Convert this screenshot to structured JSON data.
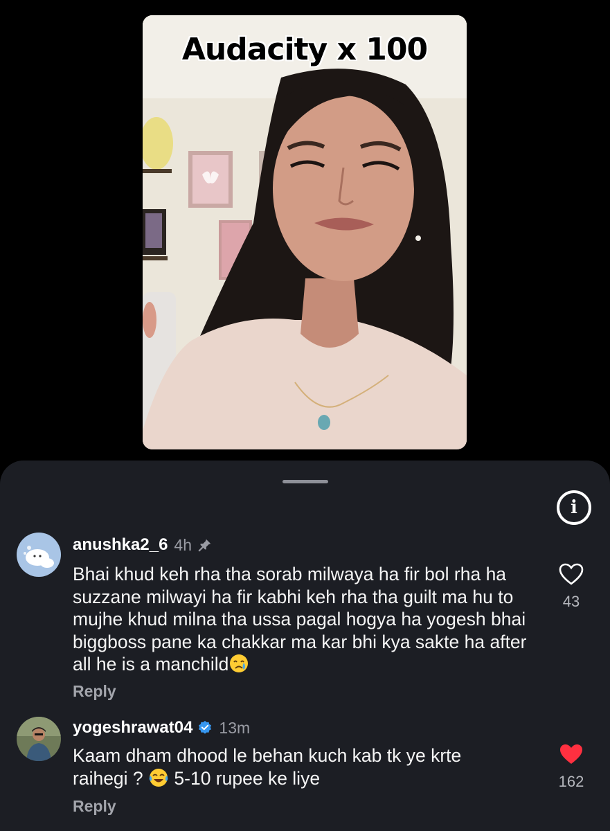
{
  "video": {
    "title": "Audacity x 100"
  },
  "sheet": {
    "info_label": "i"
  },
  "comments": [
    {
      "username": "anushka2_6",
      "time": "4h",
      "pinned": true,
      "text": "Bhai khud keh rha tha sorab milwaya ha fir bol rha ha suzzane milwayi ha  fir kabhi keh rha tha guilt ma hu to mujhe khud milna tha ussa pagal hogya ha yogesh bhai biggboss pane ka chakkar ma kar bhi kya sakte ha after all he is a manchild",
      "emoji": "crying-face",
      "reply": "Reply",
      "likes": "43",
      "liked": false
    },
    {
      "username": "yogeshrawat04",
      "verified": true,
      "time": "13m",
      "text_part1": "Kaam dham dhood le behan kuch kab tk ye krte raihegi ?",
      "emoji": "tears-of-joy",
      "text_part2": "5-10 rupee ke liye",
      "reply": "Reply",
      "likes": "162",
      "liked": true
    }
  ],
  "colors": {
    "sheet_bg": "#1c1e24",
    "like_red": "#ff3040",
    "verified_blue": "#3797f0"
  }
}
